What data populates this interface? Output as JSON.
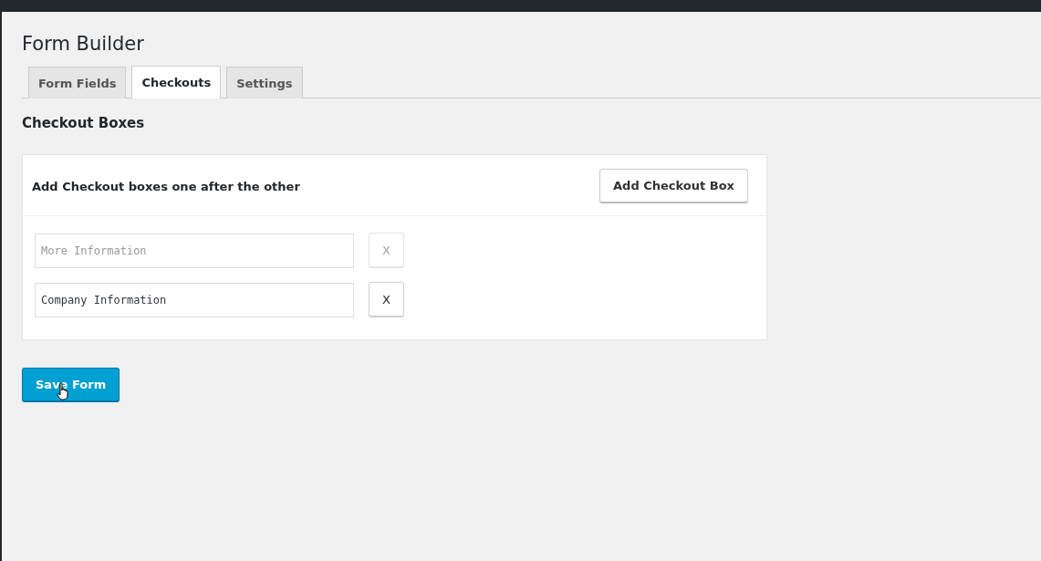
{
  "page": {
    "title": "Form Builder"
  },
  "tabs": [
    {
      "label": "Form Fields",
      "selected": false
    },
    {
      "label": "Checkouts",
      "selected": true
    },
    {
      "label": "Settings",
      "selected": false
    }
  ],
  "section": {
    "heading": "Checkout Boxes"
  },
  "card": {
    "instruction": "Add Checkout boxes one after the other",
    "add_button": "Add Checkout Box",
    "boxes": [
      {
        "placeholder": "More Information",
        "remove_label": "X",
        "disabled": true
      },
      {
        "value": "Company Information",
        "remove_label": "X",
        "disabled": false
      }
    ]
  },
  "save_button": "Save Form"
}
